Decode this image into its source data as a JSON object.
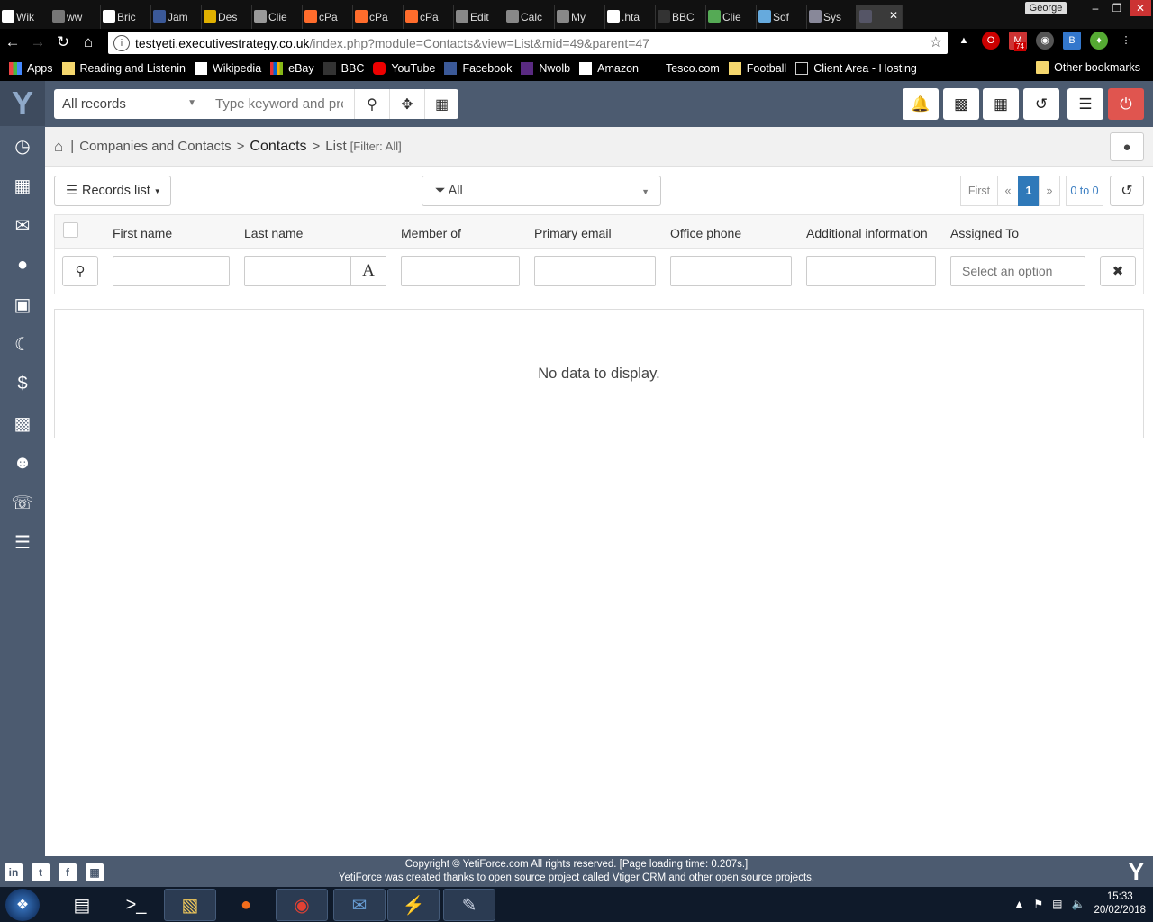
{
  "browser": {
    "tabs": [
      {
        "label": "Wik",
        "icon": "wikipedia-icon",
        "color": "#fff"
      },
      {
        "label": "ww",
        "icon": "page-icon",
        "color": "#777"
      },
      {
        "label": "Bric",
        "icon": "github-icon",
        "color": "#fff"
      },
      {
        "label": "Jam",
        "icon": "facebook-icon",
        "color": "#3b5998"
      },
      {
        "label": "Des",
        "icon": "shield-icon",
        "color": "#e0b000"
      },
      {
        "label": "Clie",
        "icon": "page-icon",
        "color": "#999"
      },
      {
        "label": "cPa",
        "icon": "cpanel-icon",
        "color": "#ff6c2c"
      },
      {
        "label": "cPa",
        "icon": "cpanel-icon",
        "color": "#ff6c2c"
      },
      {
        "label": "cPa",
        "icon": "cpanel-icon",
        "color": "#ff6c2c"
      },
      {
        "label": "Edit",
        "icon": "pro-icon",
        "color": "#888"
      },
      {
        "label": "Calc",
        "icon": "pro-icon",
        "color": "#888"
      },
      {
        "label": "My",
        "icon": "pro-icon",
        "color": "#888"
      },
      {
        "label": ".hta",
        "icon": "github-icon",
        "color": "#fff"
      },
      {
        "label": "BBC",
        "icon": "bbc-icon",
        "color": "#333"
      },
      {
        "label": "Clie",
        "icon": "leaf-icon",
        "color": "#5a5"
      },
      {
        "label": "Sof",
        "icon": "chart-icon",
        "color": "#6ad"
      },
      {
        "label": "Sys",
        "icon": "yeti-icon",
        "color": "#889"
      }
    ],
    "active_tab_close": "✕",
    "user_badge": "George",
    "url_host": "testyeti.executivestrategy.co.uk",
    "url_path": "/index.php?module=Contacts&view=List&mid=49&parent=47",
    "gmail_count": "74",
    "bookmarks": [
      {
        "label": "Apps",
        "icon": "apps-icon"
      },
      {
        "label": "Reading and Listenin",
        "icon": "folder-icon"
      },
      {
        "label": "Wikipedia",
        "icon": "wikipedia-icon"
      },
      {
        "label": "eBay",
        "icon": "ebay-icon"
      },
      {
        "label": "BBC",
        "icon": "bbc-icon"
      },
      {
        "label": "YouTube",
        "icon": "youtube-icon"
      },
      {
        "label": "Facebook",
        "icon": "facebook-icon"
      },
      {
        "label": "Nwolb",
        "icon": "natwest-icon"
      },
      {
        "label": "Amazon",
        "icon": "amazon-icon"
      },
      {
        "label": "Tesco.com",
        "icon": "tesco-icon"
      },
      {
        "label": "Football",
        "icon": "folder-icon"
      },
      {
        "label": "Client Area - Hosting",
        "icon": "page-icon"
      }
    ],
    "other_bookmarks": "Other bookmarks"
  },
  "topbar": {
    "records_select": "All records",
    "search_placeholder": "Type keyword and pre"
  },
  "breadcrumb": {
    "module_group": "Companies and Contacts",
    "module": "Contacts",
    "view": "List",
    "filter": "[Filter: All]"
  },
  "toolbar": {
    "records_list": "Records list",
    "filter_value": "All",
    "pager": {
      "first": "First",
      "prev": "«",
      "current": "1",
      "next": "»",
      "count": "0 to 0"
    }
  },
  "table": {
    "columns": [
      "First name",
      "Last name",
      "Member of",
      "Primary email",
      "Office phone",
      "Additional information",
      "Assigned To"
    ],
    "assigned_placeholder": "Select an option",
    "font_toggle": "A",
    "empty_message": "No data to display."
  },
  "footer": {
    "line1": "Copyright © YetiForce.com All rights reserved. [Page loading time: 0.207s.]",
    "line2": "YetiForce was created thanks to open source project called Vtiger CRM and other open source projects."
  },
  "taskbar": {
    "time": "15:33",
    "date": "20/02/2018"
  },
  "colors": {
    "sidebar": "#4c5b70",
    "accent": "#2f79b9",
    "power": "#e0554f"
  }
}
